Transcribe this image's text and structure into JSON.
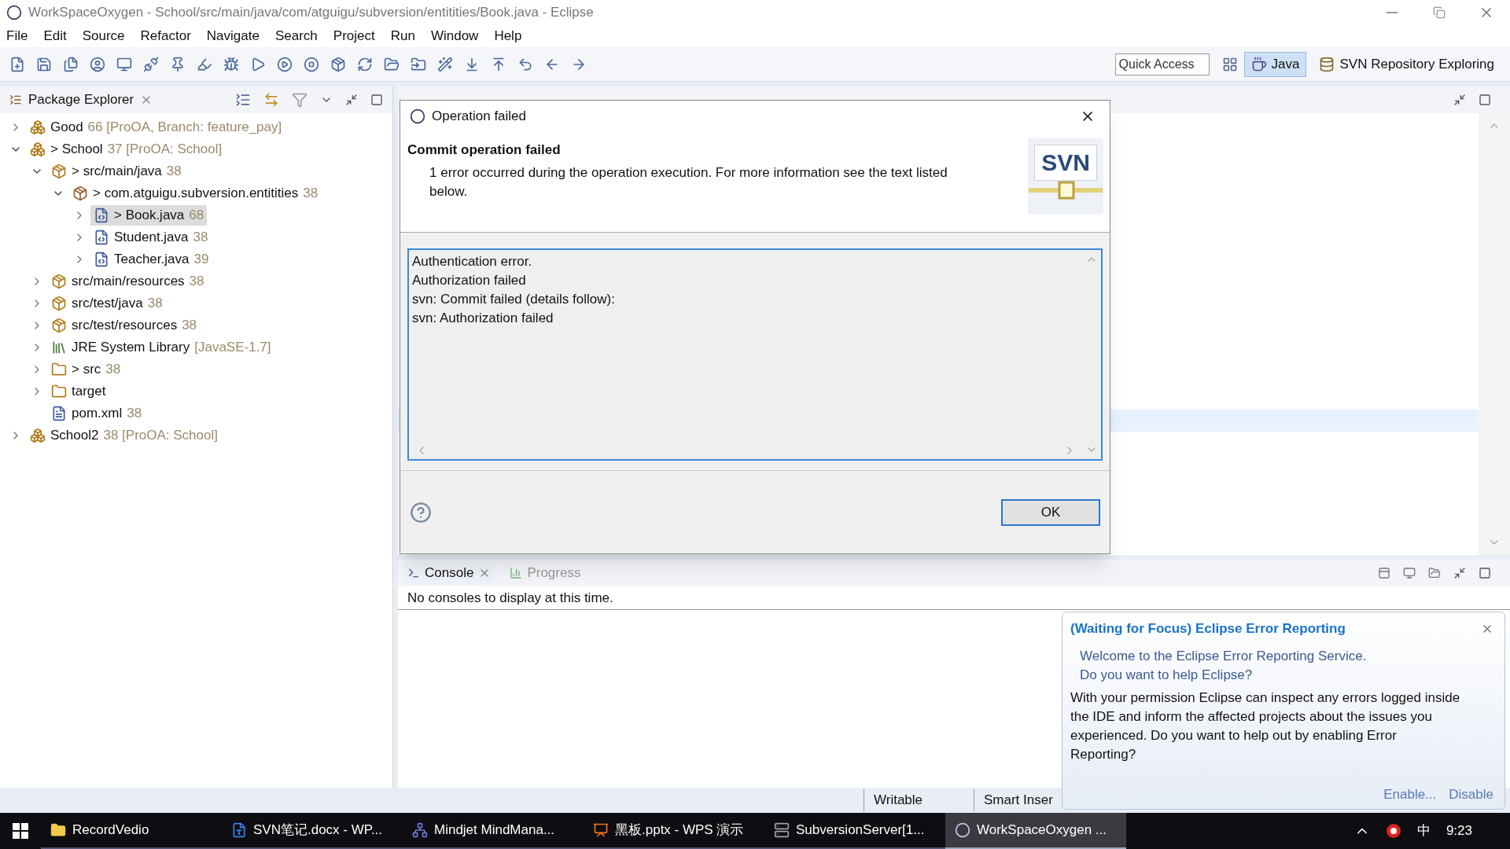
{
  "window": {
    "title": "WorkSpaceOxygen - School/src/main/java/com/atguigu/subversion/entitities/Book.java - Eclipse"
  },
  "menu": [
    "File",
    "Edit",
    "Source",
    "Refactor",
    "Navigate",
    "Search",
    "Project",
    "Run",
    "Window",
    "Help"
  ],
  "quick_access": {
    "placeholder": "Quick Access"
  },
  "perspectives": [
    {
      "label": "Java",
      "selected": true
    },
    {
      "label": "SVN Repository Exploring",
      "selected": false
    }
  ],
  "package_explorer": {
    "title": "Package Explorer",
    "items": [
      {
        "kind": "project",
        "label": "Good",
        "decoration": "66 [ProOA, Branch: feature_pay]",
        "expanded": false,
        "selected": false
      },
      {
        "kind": "project",
        "label": "> School",
        "decoration": "37 [ProOA: School]",
        "expanded": true,
        "selected": false,
        "children": [
          {
            "kind": "source-folder",
            "label": "> src/main/java",
            "decoration": "38",
            "expanded": true,
            "selected": false,
            "children": [
              {
                "kind": "package",
                "label": "> com.atguigu.subversion.entitities",
                "decoration": "38",
                "expanded": true,
                "selected": false,
                "children": [
                  {
                    "kind": "java-file",
                    "label": "> Book.java",
                    "decoration": "68",
                    "expanded": false,
                    "selected": true
                  },
                  {
                    "kind": "java-file",
                    "label": "Student.java",
                    "decoration": "38",
                    "expanded": false,
                    "selected": false
                  },
                  {
                    "kind": "java-file",
                    "label": "Teacher.java",
                    "decoration": "39",
                    "expanded": false,
                    "selected": false
                  }
                ]
              }
            ]
          },
          {
            "kind": "source-folder",
            "label": "src/main/resources",
            "decoration": "38",
            "expanded": false,
            "selected": false
          },
          {
            "kind": "source-folder",
            "label": "src/test/java",
            "decoration": "38",
            "expanded": false,
            "selected": false
          },
          {
            "kind": "source-folder",
            "label": "src/test/resources",
            "decoration": "38",
            "expanded": false,
            "selected": false
          },
          {
            "kind": "library",
            "label": "JRE System Library",
            "decoration": "[JavaSE-1.7]",
            "expanded": false,
            "selected": false
          },
          {
            "kind": "folder",
            "label": "> src",
            "decoration": "38",
            "expanded": false,
            "selected": false
          },
          {
            "kind": "folder",
            "label": "target",
            "expanded": false,
            "selected": false
          },
          {
            "kind": "xml-file",
            "label": "pom.xml",
            "decoration": "38",
            "selected": false
          }
        ]
      },
      {
        "kind": "project",
        "label": "School2",
        "decoration": "38 [ProOA: School]",
        "expanded": false,
        "selected": false
      }
    ]
  },
  "dialog": {
    "title": "Operation failed",
    "heading": "Commit operation failed",
    "message": "1 error occurred during the operation execution. For more information see the text listed below.",
    "logo": "SVN",
    "details": [
      "Authentication error.",
      "Authorization failed",
      "svn: Commit failed (details follow):",
      "svn: Authorization failed"
    ],
    "buttons": [
      "OK"
    ]
  },
  "console": {
    "tabs": [
      {
        "label": "Console",
        "selected": true
      },
      {
        "label": "Progress",
        "selected": false
      }
    ],
    "message": "No consoles to display at this time."
  },
  "status_bar": [
    "Writable",
    "Smart Inser"
  ],
  "notification": {
    "title": "(Waiting for Focus) Eclipse Error Reporting",
    "intro": [
      "Welcome to the Eclipse Error Reporting Service.",
      "Do you want to help Eclipse?"
    ],
    "body": "With your permission Eclipse can inspect any errors logged inside the IDE and inform the affected projects about the issues you experienced. Do you want to help out by enabling Error Reporting?",
    "links": [
      "Enable...",
      "Disable"
    ]
  },
  "taskbar": {
    "items": [
      {
        "kind": "folder",
        "label": "RecordVedio",
        "selected": false
      },
      {
        "kind": "word",
        "label": "SVN笔记.docx - WP...",
        "selected": false
      },
      {
        "kind": "mindmap",
        "label": "Mindjet MindMana...",
        "selected": false
      },
      {
        "kind": "slides",
        "label": "黑板.pptx - WPS 演示",
        "selected": false
      },
      {
        "kind": "server",
        "label": "SubversionServer[1...",
        "selected": false
      },
      {
        "kind": "eclipse",
        "label": "WorkSpaceOxygen ...",
        "selected": true
      }
    ],
    "ime": "中",
    "clock": "9:23"
  }
}
